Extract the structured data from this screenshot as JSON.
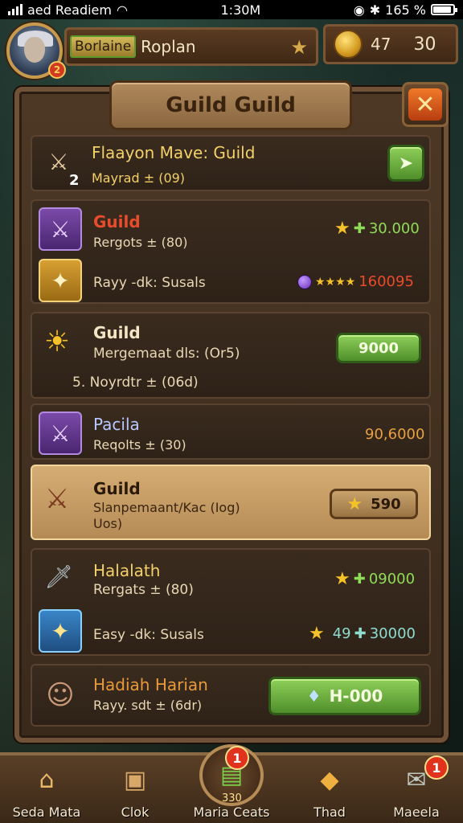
{
  "status": {
    "carrier": "aed Readiem",
    "time": "1:30M",
    "battery": "165 %"
  },
  "player": {
    "nameplate": "Borlaine",
    "name": "Roplan",
    "notif": "2"
  },
  "currency": {
    "v1": "47",
    "v2": "30"
  },
  "screen": {
    "title": "Guild Guild"
  },
  "rows": [
    {
      "title": "Flaayon Mave: Guild",
      "sub": "Mayrad ± (09)",
      "prefix": "2"
    },
    {
      "title": "Guild",
      "sub": "Rergots ± (80)",
      "value": "30.000",
      "sub2": "Rayy -dk: Susals",
      "value2": "160095"
    },
    {
      "title": "Guild",
      "sub": "Mergemaat dls: (Or5)",
      "sub2": "5. Noyrdtr ± (06d)",
      "button": "9000"
    },
    {
      "title": "Pacila",
      "sub": "Reqolts ± (30)",
      "value": "90,6000"
    },
    {
      "title": "Guild",
      "sub": "Slanpemaant/Kac (Iog)",
      "sub2": "Uos)",
      "button": "590"
    },
    {
      "title": "Halalath",
      "sub": "Rergats ± (80)",
      "value": "09000",
      "sub2": "Easy -dk: Susals",
      "value2": "30000",
      "value2pre": "49"
    },
    {
      "title": "Hadiah Harian",
      "sub": "Rayy. sdt ± (6dr)",
      "button": "H-000"
    }
  ],
  "tabs": [
    {
      "label": "Seda Mata"
    },
    {
      "label": "Clok"
    },
    {
      "label": "Maria Ceats",
      "badge": "1",
      "extra": "330"
    },
    {
      "label": "Thad"
    },
    {
      "label": "Maeela",
      "badge": "1"
    }
  ],
  "colors": {
    "red": "#e84c2c",
    "gold": "#f2d06a",
    "green": "#8fdc58",
    "lilac": "#b8c8ff"
  }
}
